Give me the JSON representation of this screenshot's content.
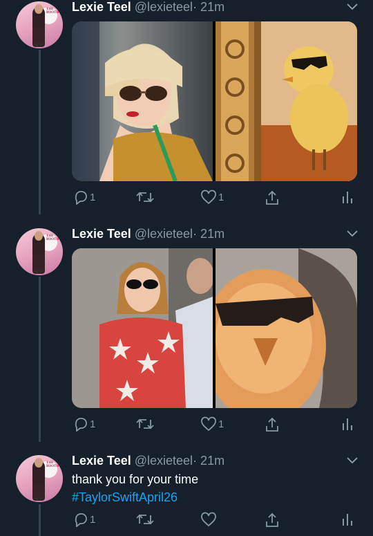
{
  "colors": {
    "background": "#15202b",
    "text_primary": "#ffffff",
    "text_secondary": "#8899a6",
    "link": "#1da1f2",
    "thread_line": "#38444d"
  },
  "avatar_caption": "THE BOOTH",
  "tweets": [
    {
      "author_name": "Lexie Teel",
      "handle": "@lexieteel",
      "timestamp": "· 21m",
      "text": "",
      "hashtag": "",
      "media_count": 2,
      "actions": {
        "reply": "1",
        "retweet": "",
        "like": "1"
      },
      "icons": [
        "reply-icon",
        "retweet-icon",
        "like-icon",
        "share-icon",
        "analytics-icon",
        "chevron-down-icon"
      ]
    },
    {
      "author_name": "Lexie Teel",
      "handle": "@lexieteel",
      "timestamp": "· 21m",
      "text": "",
      "hashtag": "",
      "media_count": 2,
      "actions": {
        "reply": "1",
        "retweet": "",
        "like": "1"
      },
      "icons": [
        "reply-icon",
        "retweet-icon",
        "like-icon",
        "share-icon",
        "analytics-icon",
        "chevron-down-icon"
      ]
    },
    {
      "author_name": "Lexie Teel",
      "handle": "@lexieteel",
      "timestamp": "· 21m",
      "text": "thank you for your time",
      "hashtag": "#TaylorSwiftApril26",
      "media_count": 0,
      "actions": {
        "reply": "1",
        "retweet": "",
        "like": ""
      },
      "icons": [
        "reply-icon",
        "retweet-icon",
        "like-icon",
        "share-icon",
        "analytics-icon",
        "chevron-down-icon"
      ]
    }
  ]
}
